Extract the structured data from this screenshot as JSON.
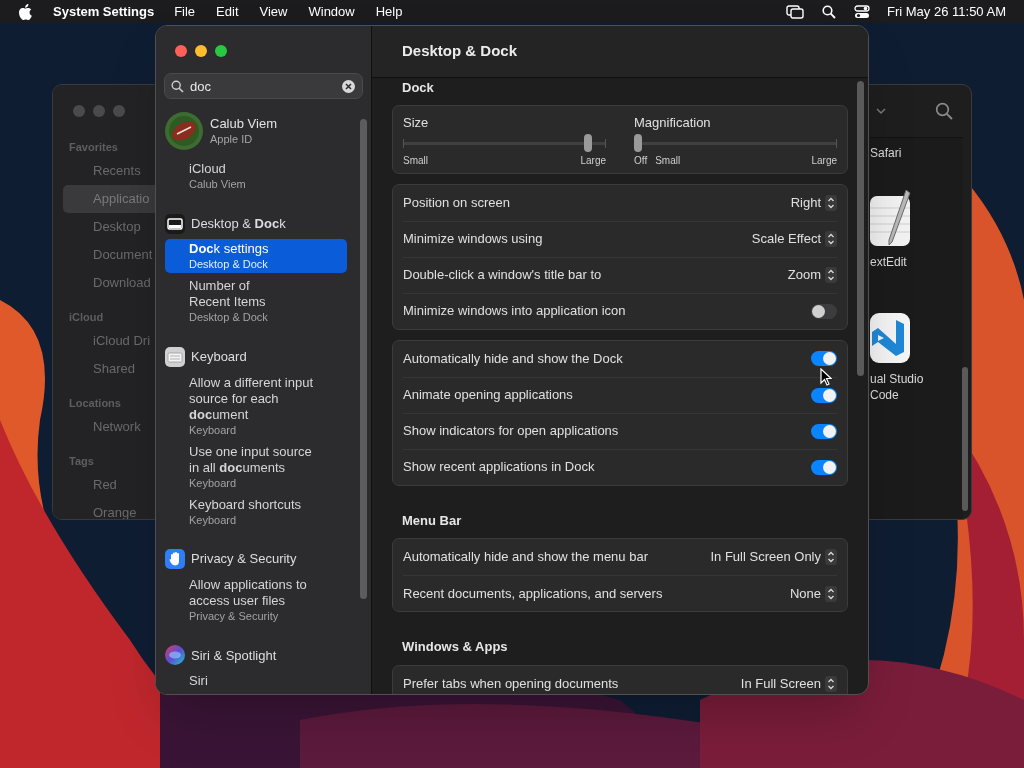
{
  "menu_bar": {
    "app": "System Settings",
    "menus": [
      "File",
      "Edit",
      "View",
      "Window",
      "Help"
    ],
    "clock": "Fri May 26 11:50 AM"
  },
  "finder": {
    "sidebar": [
      {
        "heading": "Favorites",
        "items": [
          {
            "label": "Recents",
            "selected": false
          },
          {
            "label": "Applicatio",
            "selected": true
          },
          {
            "label": "Desktop",
            "selected": false
          },
          {
            "label": "Document",
            "selected": false
          },
          {
            "label": "Download",
            "selected": false
          }
        ]
      },
      {
        "heading": "iCloud",
        "items": [
          {
            "label": "iCloud Dri",
            "selected": false
          },
          {
            "label": "Shared",
            "selected": false
          }
        ]
      },
      {
        "heading": "Locations",
        "items": [
          {
            "label": "Network",
            "selected": false
          }
        ]
      },
      {
        "heading": "Tags",
        "items": [
          {
            "label": "Red",
            "selected": false
          },
          {
            "label": "Orange",
            "selected": false
          }
        ]
      }
    ],
    "apps": [
      {
        "label": "Safari"
      },
      {
        "label": "extEdit"
      },
      {
        "label": "ual Studio\nCode"
      }
    ]
  },
  "settings": {
    "search": {
      "value": "doc"
    },
    "results": [
      {
        "kind": "account",
        "title": "Calub Viem",
        "subtitle": "Apple ID",
        "selected": false
      },
      {
        "kind": "sub",
        "title": "iCloud",
        "subtitle": "Calub Viem",
        "selected": false
      },
      {
        "kind": "group",
        "title": "Desktop & **Doc**k",
        "selected": false
      },
      {
        "kind": "sub",
        "title": "**Doc**k settings",
        "subtitle": "Desktop & Dock",
        "selected": true
      },
      {
        "kind": "sub",
        "title": "Number of\nRecent Items",
        "subtitle": "Desktop & Dock",
        "selected": false
      },
      {
        "kind": "group",
        "title": "Keyboard",
        "selected": false
      },
      {
        "kind": "sub",
        "title": "Allow a different input\nsource for each\n**doc**ument",
        "subtitle": "Keyboard",
        "selected": false
      },
      {
        "kind": "sub",
        "title": "Use one input source\nin all **doc**uments",
        "subtitle": "Keyboard",
        "selected": false
      },
      {
        "kind": "sub",
        "title": "Keyboard shortcuts",
        "subtitle": "Keyboard",
        "selected": false
      },
      {
        "kind": "group",
        "title": "Privacy & Security",
        "selected": false
      },
      {
        "kind": "sub",
        "title": "Allow applications to\naccess user files",
        "subtitle": "Privacy & Security",
        "selected": false
      },
      {
        "kind": "group",
        "title": "Siri & Spotlight",
        "selected": false
      },
      {
        "kind": "sub",
        "title": "Siri",
        "selected": false
      }
    ],
    "title": "Desktop & Dock",
    "sections": [
      {
        "heading": "Dock",
        "cards": [
          {
            "kind": "sliders",
            "sliders": [
              {
                "label": "Size",
                "level": 0.93,
                "marks": [
                  "Small",
                  "Large"
                ]
              },
              {
                "label": "Magnification",
                "level": 0,
                "marks": [
                  "Off",
                  "Small",
                  "Large"
                ]
              }
            ]
          },
          {
            "kind": "rows",
            "rows": [
              {
                "kind": "popup",
                "label": "Position on screen",
                "value": "Right"
              },
              {
                "kind": "popup",
                "label": "Minimize windows using",
                "value": "Scale Effect"
              },
              {
                "kind": "popup",
                "label": "Double-click a window's title bar to",
                "value": "Zoom"
              },
              {
                "kind": "toggle",
                "label": "Minimize windows into application icon",
                "on": false
              }
            ]
          },
          {
            "kind": "rows",
            "rows": [
              {
                "kind": "toggle",
                "label": "Automatically hide and show the Dock",
                "on": true
              },
              {
                "kind": "toggle",
                "label": "Animate opening applications",
                "on": true
              },
              {
                "kind": "toggle",
                "label": "Show indicators for open applications",
                "on": true
              },
              {
                "kind": "toggle",
                "label": "Show recent applications in Dock",
                "on": true
              }
            ]
          }
        ]
      },
      {
        "heading": "Menu Bar",
        "cards": [
          {
            "kind": "rows",
            "rows": [
              {
                "kind": "popup",
                "label": "Automatically hide and show the menu bar",
                "value": "In Full Screen Only"
              },
              {
                "kind": "popup",
                "label": "Recent documents, applications, and servers",
                "value": "None"
              }
            ]
          }
        ]
      },
      {
        "heading": "Windows & Apps",
        "cards": [
          {
            "kind": "rows",
            "rows": [
              {
                "kind": "popup",
                "label": "Prefer tabs when opening documents",
                "value": "In Full Screen"
              }
            ]
          }
        ]
      }
    ]
  }
}
